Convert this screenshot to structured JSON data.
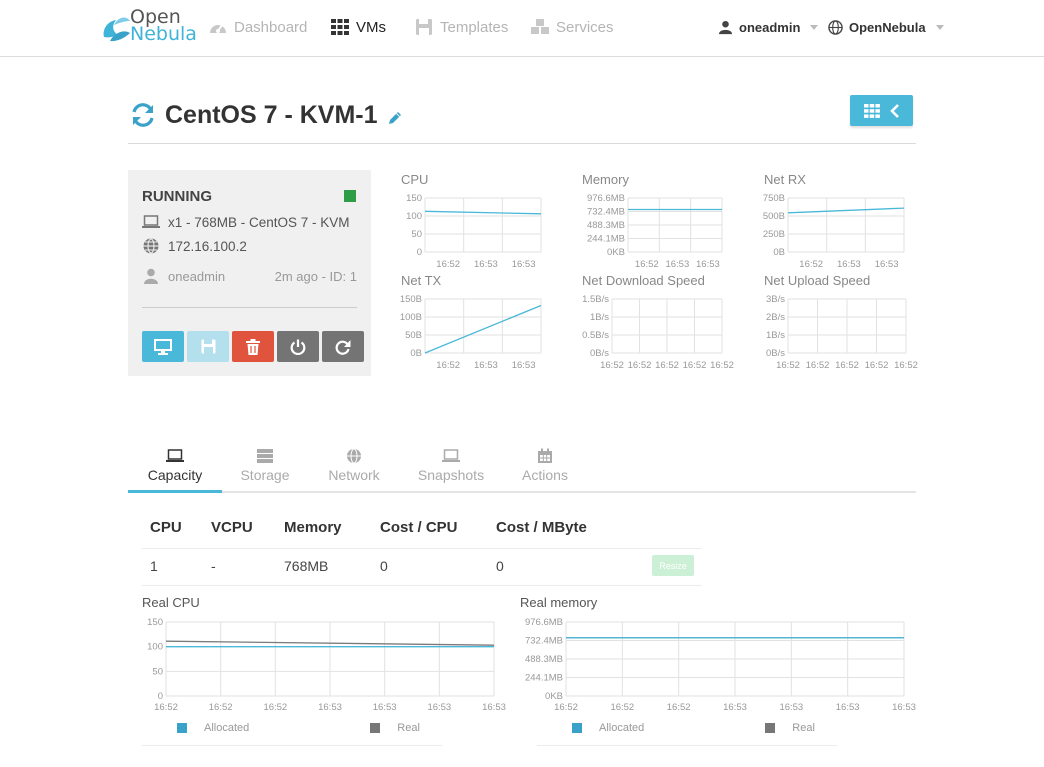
{
  "brand": {
    "line1": "Open",
    "line2": "Nebula"
  },
  "nav": {
    "dashboard": "Dashboard",
    "vms": "VMs",
    "templates": "Templates",
    "services": "Services",
    "user": "oneadmin",
    "zone": "OpenNebula"
  },
  "vm": {
    "name": "CentOS 7 - KVM-1",
    "state": "RUNNING",
    "summary": "x1 - 768MB - CentOS 7 - KVM",
    "ip": "172.16.100.2",
    "owner": "oneadmin",
    "meta": "2m ago - ID: 1"
  },
  "tabs": [
    "Capacity",
    "Storage",
    "Network",
    "Snapshots",
    "Actions"
  ],
  "capacity": {
    "headers": [
      "CPU",
      "VCPU",
      "Memory",
      "Cost / CPU",
      "Cost / MByte"
    ],
    "values": [
      "1",
      "-",
      "768MB",
      "0",
      "0"
    ],
    "resize_label": "Resize"
  },
  "legend": {
    "allocated": "Allocated",
    "real": "Real"
  },
  "colors": {
    "accent": "#4ab8d9",
    "running": "#2e9e46",
    "danger": "#e0533d",
    "real_line": "#7a7a7a"
  },
  "chart_data": [
    {
      "type": "line",
      "title": "CPU",
      "yticks": [
        "150",
        "100",
        "50",
        "0"
      ],
      "ylim": [
        0,
        150
      ],
      "x": [
        "16:52",
        "16:53",
        "16:53"
      ],
      "series": [
        {
          "values": [
            113,
            106
          ]
        }
      ]
    },
    {
      "type": "line",
      "title": "Memory",
      "yticks": [
        "976.6MB",
        "732.4MB",
        "488.3MB",
        "244.1MB",
        "0KB"
      ],
      "ylim": [
        0,
        1000000
      ],
      "x": [
        "16:52",
        "16:53",
        "16:53"
      ],
      "series": [
        {
          "values": [
            786432,
            786432
          ]
        }
      ]
    },
    {
      "type": "line",
      "title": "Net RX",
      "yticks": [
        "750B",
        "500B",
        "250B",
        "0B"
      ],
      "ylim": [
        0,
        750
      ],
      "x": [
        "16:52",
        "16:53",
        "16:53"
      ],
      "series": [
        {
          "values": [
            545,
            610
          ]
        }
      ]
    },
    {
      "type": "line",
      "title": "Net TX",
      "yticks": [
        "150B",
        "100B",
        "50B",
        "0B"
      ],
      "ylim": [
        0,
        150
      ],
      "x": [
        "16:52",
        "16:53",
        "16:53"
      ],
      "series": [
        {
          "values": [
            0,
            132
          ]
        }
      ]
    },
    {
      "type": "line",
      "title": "Net Download Speed",
      "yticks": [
        "1.5B/s",
        "1B/s",
        "0.5B/s",
        "0B/s"
      ],
      "ylim": [
        0,
        1.5
      ],
      "x": [
        "16:52",
        "16:52",
        "16:52",
        "16:52",
        "16:52"
      ],
      "series": []
    },
    {
      "type": "line",
      "title": "Net Upload Speed",
      "yticks": [
        "3B/s",
        "2B/s",
        "1B/s",
        "0B/s"
      ],
      "ylim": [
        0,
        3
      ],
      "x": [
        "16:52",
        "16:52",
        "16:52",
        "16:52",
        "16:52"
      ],
      "series": []
    },
    {
      "type": "line",
      "title": "Real CPU",
      "yticks": [
        "150",
        "100",
        "50",
        "0"
      ],
      "ylim": [
        0,
        150
      ],
      "x": [
        "16:52",
        "16:52",
        "16:52",
        "16:53",
        "16:53",
        "16:53",
        "16:53"
      ],
      "series": [
        {
          "name": "Allocated",
          "values": [
            100,
            100
          ]
        },
        {
          "name": "Real",
          "values": [
            111,
            103
          ]
        }
      ]
    },
    {
      "type": "line",
      "title": "Real memory",
      "yticks": [
        "976.6MB",
        "732.4MB",
        "488.3MB",
        "244.1MB",
        "0KB"
      ],
      "ylim": [
        0,
        1000000
      ],
      "x": [
        "16:52",
        "16:52",
        "16:52",
        "16:53",
        "16:53",
        "16:53",
        "16:53"
      ],
      "series": [
        {
          "name": "Allocated",
          "values": [
            786432,
            786432
          ]
        },
        {
          "name": "Real",
          "values": [
            786432,
            786432
          ]
        }
      ]
    }
  ]
}
